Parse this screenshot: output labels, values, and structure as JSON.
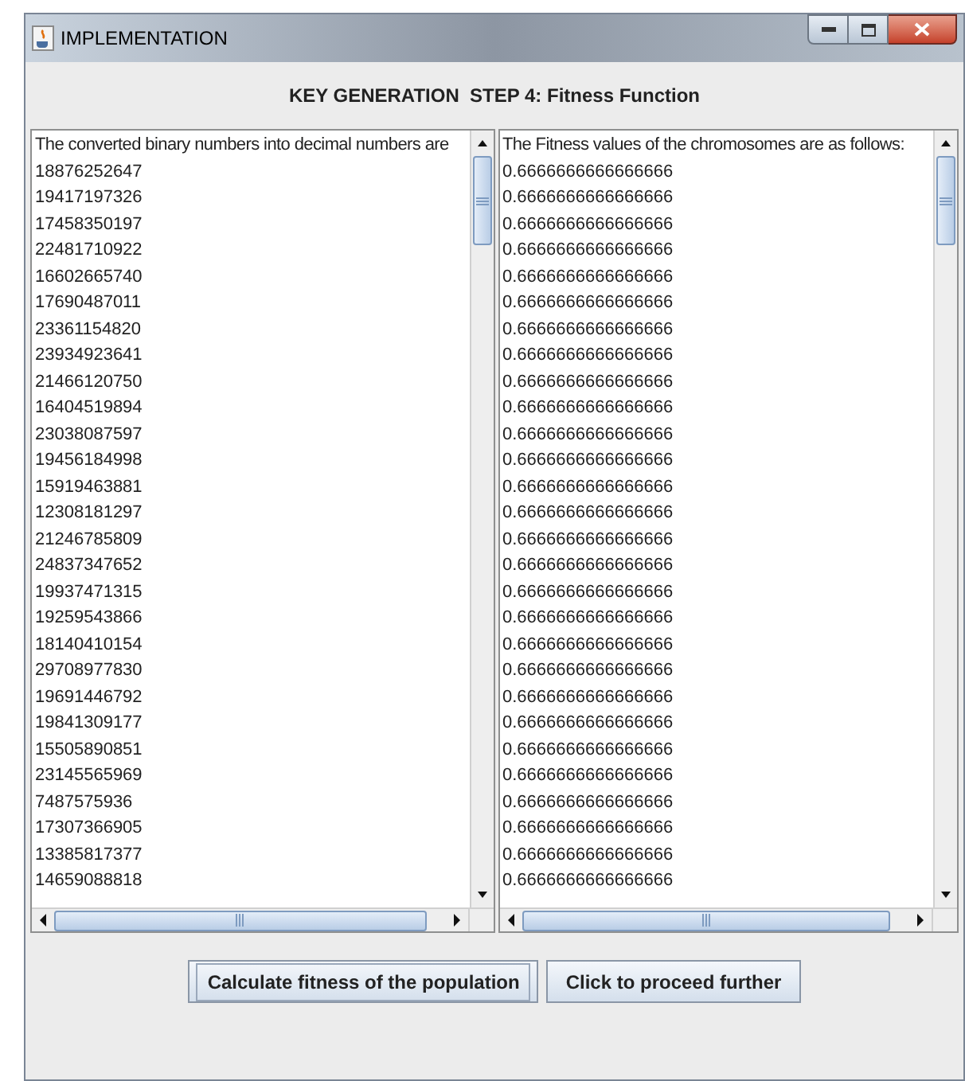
{
  "window": {
    "title": "IMPLEMENTATION"
  },
  "heading": "KEY GENERATION  STEP 4: Fitness Function",
  "lists": [
    {
      "header": "The converted binary numbers into decimal numbers are",
      "items": [
        "18876252647",
        "19417197326",
        "17458350197",
        "22481710922",
        "16602665740",
        "17690487011",
        "23361154820",
        "23934923641",
        "21466120750",
        "16404519894",
        "23038087597",
        "19456184998",
        "15919463881",
        "12308181297",
        "21246785809",
        "24837347652",
        "19937471315",
        "19259543866",
        "18140410154",
        "29708977830",
        "19691446792",
        "19841309177",
        "15505890851",
        "23145565969",
        "7487575936",
        "17307366905",
        "13385817377",
        "14659088818"
      ]
    },
    {
      "header": "The Fitness values of the chromosomes are as follows:",
      "items": [
        "0.6666666666666666",
        "0.6666666666666666",
        "0.6666666666666666",
        "0.6666666666666666",
        "0.6666666666666666",
        "0.6666666666666666",
        "0.6666666666666666",
        "0.6666666666666666",
        "0.6666666666666666",
        "0.6666666666666666",
        "0.6666666666666666",
        "0.6666666666666666",
        "0.6666666666666666",
        "0.6666666666666666",
        "0.6666666666666666",
        "0.6666666666666666",
        "0.6666666666666666",
        "0.6666666666666666",
        "0.6666666666666666",
        "0.6666666666666666",
        "0.6666666666666666",
        "0.6666666666666666",
        "0.6666666666666666",
        "0.6666666666666666",
        "0.6666666666666666",
        "0.6666666666666666",
        "0.6666666666666666",
        "0.6666666666666666"
      ]
    }
  ],
  "buttons": [
    {
      "label": "Calculate fitness of the population",
      "focused": true
    },
    {
      "label": "Click to proceed further",
      "focused": false
    }
  ]
}
